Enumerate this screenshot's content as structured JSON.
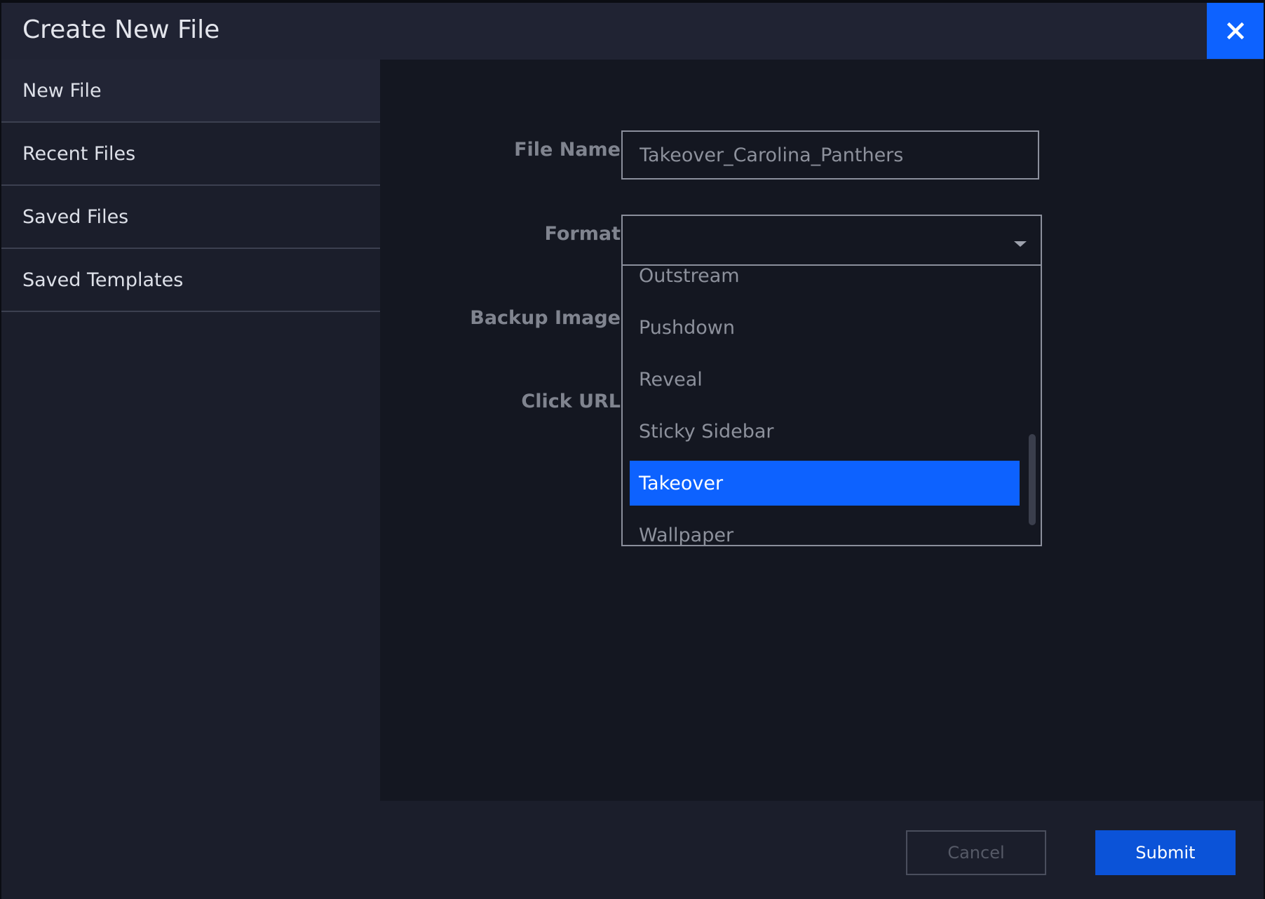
{
  "dialog": {
    "title": "Create New File",
    "close_icon": "close-icon"
  },
  "sidebar": {
    "items": [
      {
        "label": "New File",
        "active": true
      },
      {
        "label": "Recent Files"
      },
      {
        "label": "Saved Files"
      },
      {
        "label": "Saved Templates"
      }
    ]
  },
  "form": {
    "file_name": {
      "label": "File Name",
      "value": "Takeover_Carolina_Panthers"
    },
    "format": {
      "label": "Format",
      "selected": "",
      "options": [
        "Outstream",
        "Pushdown",
        "Reveal",
        "Sticky Sidebar",
        "Takeover",
        "Wallpaper"
      ],
      "highlighted": "Takeover"
    },
    "backup_image": {
      "label": "Backup Image"
    },
    "click_url": {
      "label": "Click URL"
    }
  },
  "footer": {
    "cancel_label": "Cancel",
    "submit_label": "Submit"
  },
  "colors": {
    "accent": "#0d62ff",
    "background": "#1b1e2b",
    "panel": "#141721"
  }
}
